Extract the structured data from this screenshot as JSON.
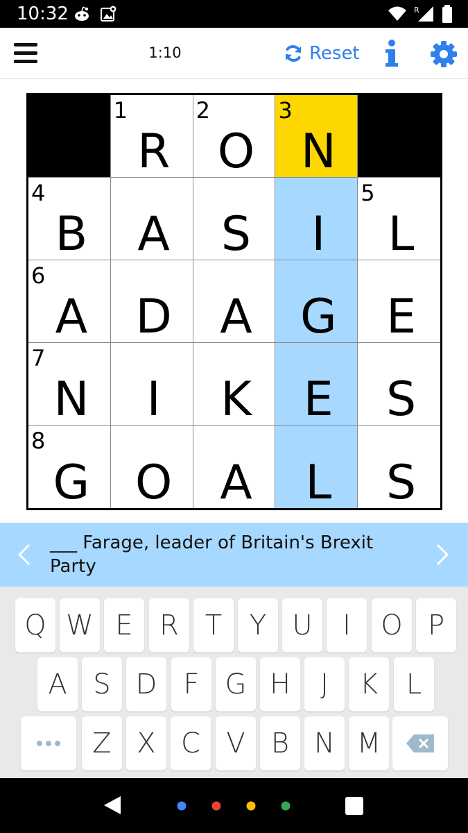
{
  "status_bar": {
    "time": "10:32",
    "left_icons": [
      "reddit-icon",
      "image-badge-icon"
    ],
    "right_icons": [
      "wifi-icon",
      "cell-signal-icon",
      "battery-icon"
    ],
    "roaming_indicator": "R"
  },
  "header": {
    "menu_icon": "hamburger-menu-icon",
    "timer": "1:10",
    "reset_label": "Reset",
    "reset_icon": "refresh-icon",
    "info_icon": "info-icon",
    "settings_icon": "gear-icon",
    "accent_color": "#2f80ed"
  },
  "puzzle": {
    "grid": [
      [
        {
          "type": "block"
        },
        {
          "num": "1",
          "letter": "R"
        },
        {
          "num": "2",
          "letter": "O"
        },
        {
          "num": "3",
          "letter": "N",
          "state": "active"
        },
        {
          "type": "block"
        }
      ],
      [
        {
          "num": "4",
          "letter": "B"
        },
        {
          "letter": "A"
        },
        {
          "letter": "S"
        },
        {
          "letter": "I",
          "state": "word"
        },
        {
          "num": "5",
          "letter": "L"
        }
      ],
      [
        {
          "num": "6",
          "letter": "A"
        },
        {
          "letter": "D"
        },
        {
          "letter": "A"
        },
        {
          "letter": "G",
          "state": "word"
        },
        {
          "letter": "E"
        }
      ],
      [
        {
          "num": "7",
          "letter": "N"
        },
        {
          "letter": "I"
        },
        {
          "letter": "K"
        },
        {
          "letter": "E",
          "state": "word"
        },
        {
          "letter": "S"
        }
      ],
      [
        {
          "num": "8",
          "letter": "G"
        },
        {
          "letter": "O"
        },
        {
          "letter": "A"
        },
        {
          "letter": "L",
          "state": "word"
        },
        {
          "letter": "S"
        }
      ]
    ],
    "colors": {
      "active_cell": "#ffd700",
      "highlighted_word": "#a7d8ff",
      "block": "#000000"
    }
  },
  "clue": {
    "text": "___ Farage, leader of Britain's Brexit Party",
    "prev_icon": "chevron-left-icon",
    "next_icon": "chevron-right-icon",
    "background": "#a7d8ff"
  },
  "keyboard": {
    "rows": [
      [
        "Q",
        "W",
        "E",
        "R",
        "T",
        "Y",
        "U",
        "I",
        "O",
        "P"
      ],
      [
        "A",
        "S",
        "D",
        "F",
        "G",
        "H",
        "J",
        "K",
        "L"
      ],
      [
        "Z",
        "X",
        "C",
        "V",
        "B",
        "N",
        "M"
      ]
    ],
    "more_key_icon": "more-dots-icon",
    "backspace_icon": "backspace-icon"
  },
  "nav_bar": {
    "icons": [
      "back-triangle-icon",
      "assistant-dots-icon",
      "recents-square-icon"
    ]
  }
}
